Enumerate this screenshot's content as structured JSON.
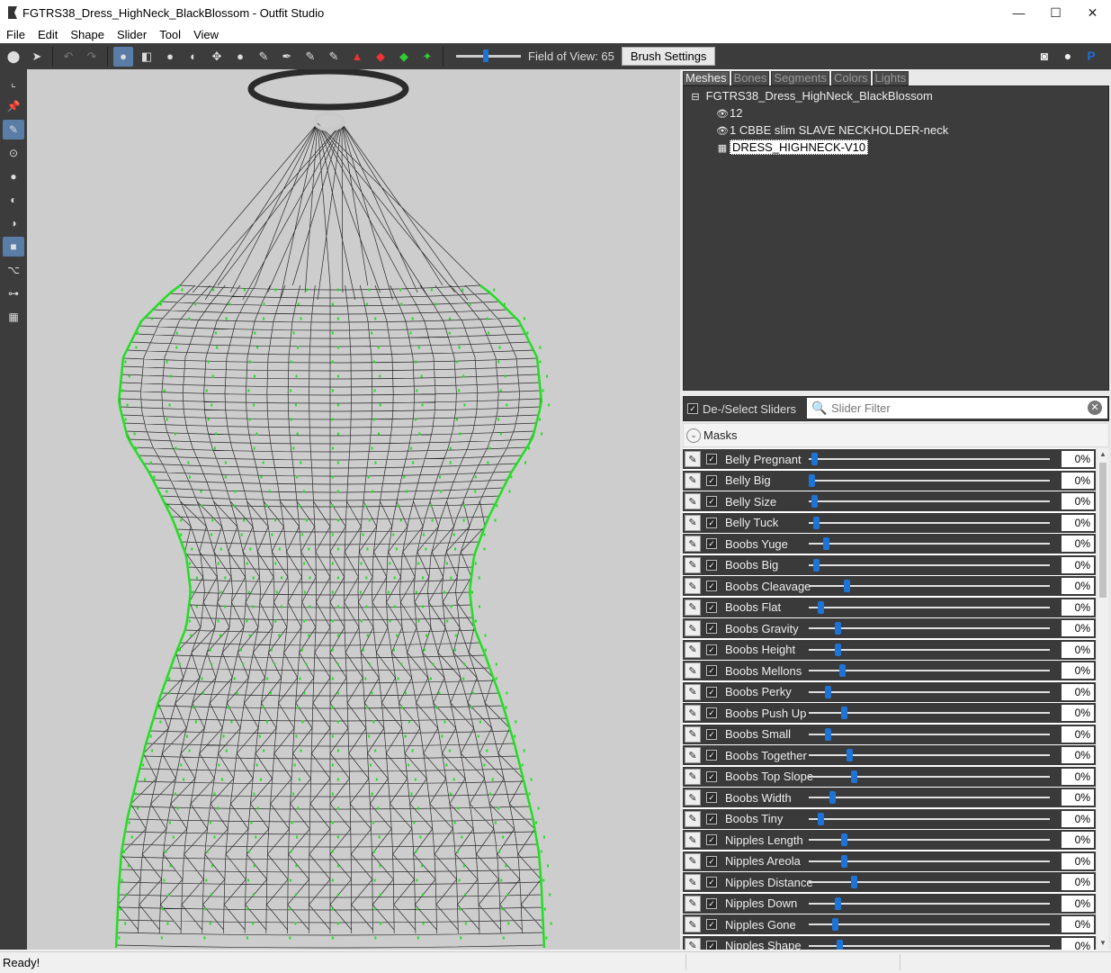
{
  "window": {
    "title": "FGTRS38_Dress_HighNeck_BlackBlossom - Outfit Studio",
    "minimize": "—",
    "maximize": "☐",
    "close": "✕"
  },
  "menu": [
    "File",
    "Edit",
    "Shape",
    "Slider",
    "Tool",
    "View"
  ],
  "toolbar": {
    "fov_label": "Field of View: 65",
    "fov_value": 65,
    "brush_settings": "Brush Settings"
  },
  "tabs": [
    {
      "label": "Meshes",
      "active": true
    },
    {
      "label": "Bones",
      "active": false
    },
    {
      "label": "Segments",
      "active": false
    },
    {
      "label": "Colors",
      "active": false
    },
    {
      "label": "Lights",
      "active": false
    }
  ],
  "tree": {
    "root": "FGTRS38_Dress_HighNeck_BlackBlossom",
    "items": [
      "12",
      "1 CBBE slim SLAVE NECKHOLDER-neck",
      "DRESS_HIGHNECK-V10"
    ]
  },
  "filter": {
    "deselect_label": "De-/Select Sliders",
    "placeholder": "Slider Filter"
  },
  "masks_label": "Masks",
  "sliders": [
    {
      "name": "Belly Pregnant",
      "value": "0%",
      "pos": 0.01
    },
    {
      "name": "Belly Big",
      "value": "0%",
      "pos": 0.0
    },
    {
      "name": "Belly Size",
      "value": "0%",
      "pos": 0.01
    },
    {
      "name": "Belly Tuck",
      "value": "0%",
      "pos": 0.02
    },
    {
      "name": "Boobs Yuge",
      "value": "0%",
      "pos": 0.06
    },
    {
      "name": "Boobs Big",
      "value": "0%",
      "pos": 0.02
    },
    {
      "name": "Boobs Cleavage",
      "value": "0%",
      "pos": 0.15
    },
    {
      "name": "Boobs Flat",
      "value": "0%",
      "pos": 0.04
    },
    {
      "name": "Boobs Gravity",
      "value": "0%",
      "pos": 0.11
    },
    {
      "name": "Boobs Height",
      "value": "0%",
      "pos": 0.11
    },
    {
      "name": "Boobs Mellons",
      "value": "0%",
      "pos": 0.13
    },
    {
      "name": "Boobs Perky",
      "value": "0%",
      "pos": 0.07
    },
    {
      "name": "Boobs Push Up",
      "value": "0%",
      "pos": 0.14
    },
    {
      "name": "Boobs Small",
      "value": "0%",
      "pos": 0.07
    },
    {
      "name": "Boobs Together",
      "value": "0%",
      "pos": 0.16
    },
    {
      "name": "Boobs Top Slope",
      "value": "0%",
      "pos": 0.18
    },
    {
      "name": "Boobs Width",
      "value": "0%",
      "pos": 0.09
    },
    {
      "name": "Boobs Tiny",
      "value": "0%",
      "pos": 0.04
    },
    {
      "name": "Nipples Length",
      "value": "0%",
      "pos": 0.14
    },
    {
      "name": "Nipples Areola",
      "value": "0%",
      "pos": 0.14
    },
    {
      "name": "Nipples Distance",
      "value": "0%",
      "pos": 0.18
    },
    {
      "name": "Nipples Down",
      "value": "0%",
      "pos": 0.11
    },
    {
      "name": "Nipples Gone",
      "value": "0%",
      "pos": 0.1
    },
    {
      "name": "Nipples Shape",
      "value": "0%",
      "pos": 0.12
    }
  ],
  "status": "Ready!",
  "colors": {
    "accent": "#1e74d6",
    "dark_panel": "#3c3c3c",
    "wire_highlight": "#22dd22"
  },
  "icons": [
    "discord-icon",
    "github-icon",
    "paypal-icon"
  ]
}
